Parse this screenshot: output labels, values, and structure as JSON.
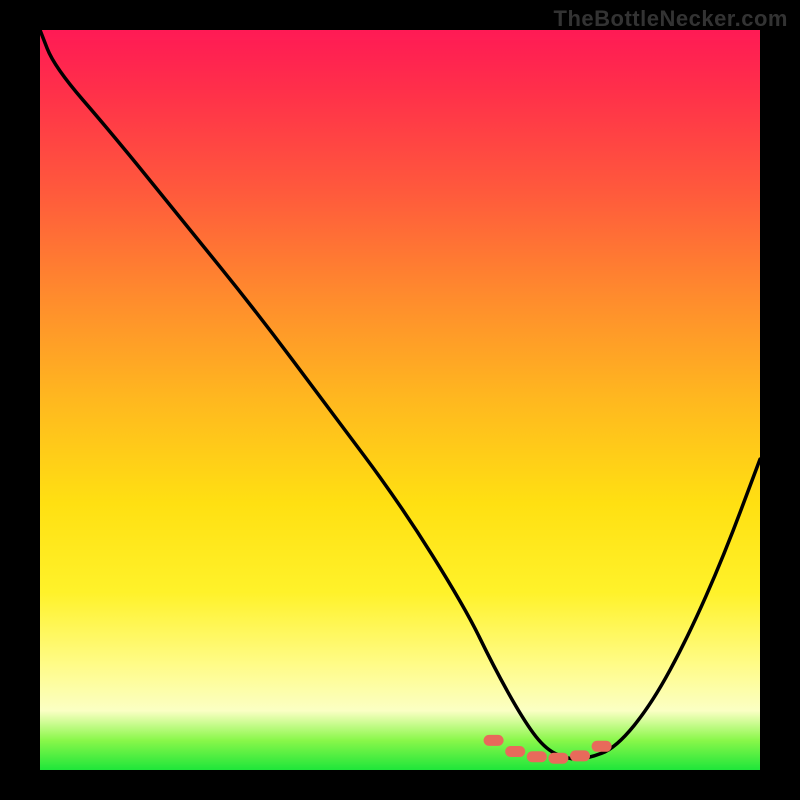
{
  "watermark": "TheBottleNecker.com",
  "chart_data": {
    "type": "line",
    "title": "",
    "xlabel": "",
    "ylabel": "",
    "xlim": [
      0,
      100
    ],
    "ylim": [
      0,
      100
    ],
    "series": [
      {
        "name": "curve",
        "x": [
          0,
          2,
          10,
          20,
          30,
          40,
          50,
          59,
          63,
          67,
          70,
          73,
          76,
          80,
          85,
          90,
          95,
          100
        ],
        "y": [
          100,
          95,
          86,
          74,
          62,
          49,
          36,
          22,
          14,
          7,
          3,
          1.5,
          1.5,
          3,
          9,
          18,
          29,
          42
        ]
      }
    ],
    "markers": {
      "name": "flat-region",
      "x": [
        63,
        66,
        69,
        72,
        75,
        78
      ],
      "y": [
        4,
        2.5,
        1.8,
        1.6,
        1.9,
        3.2
      ]
    },
    "colors": {
      "curve_stroke": "#000000",
      "marker_stroke": "#e86a5b",
      "marker_fill": "#e86a5b",
      "gradient_top": "#ff1a55",
      "gradient_bottom": "#1ee63a"
    }
  }
}
